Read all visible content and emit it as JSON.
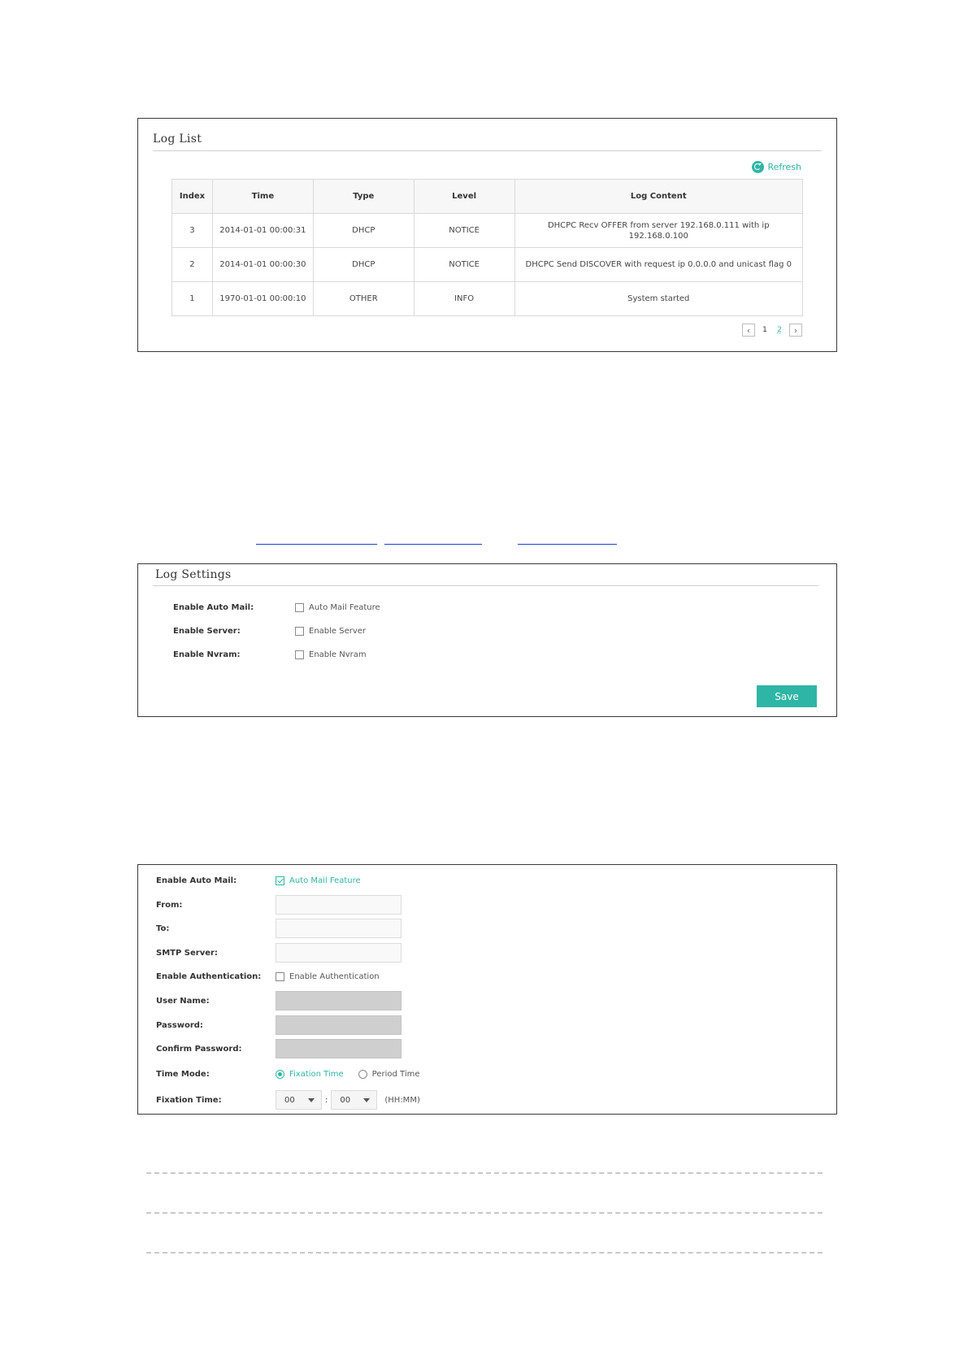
{
  "log_list": {
    "title": "Log List",
    "refresh_label": "Refresh",
    "columns": [
      "Index",
      "Time",
      "Type",
      "Level",
      "Log Content"
    ],
    "rows": [
      {
        "index": "3",
        "time": "2014-01-01 00:00:31",
        "type": "DHCP",
        "level": "NOTICE",
        "content": "DHCPC Recv OFFER from server 192.168.0.111 with ip 192.168.0.100"
      },
      {
        "index": "2",
        "time": "2014-01-01 00:00:30",
        "type": "DHCP",
        "level": "NOTICE",
        "content": "DHCPC Send DISCOVER with request ip 0.0.0.0 and unicast flag 0"
      },
      {
        "index": "1",
        "time": "1970-01-01 00:00:10",
        "type": "OTHER",
        "level": "INFO",
        "content": "System started"
      }
    ],
    "pagination": {
      "pages": [
        "1",
        "2"
      ],
      "current": "2"
    }
  },
  "log_settings": {
    "title": "Log Settings",
    "fields": [
      {
        "label": "Enable Auto Mail:",
        "option": "Auto Mail Feature",
        "checked": false
      },
      {
        "label": "Enable Server:",
        "option": "Enable Server",
        "checked": false
      },
      {
        "label": "Enable Nvram:",
        "option": "Enable Nvram",
        "checked": false
      }
    ],
    "save_label": "Save"
  },
  "mail_settings": {
    "auto_mail": {
      "label": "Enable Auto Mail:",
      "option": "Auto Mail Feature",
      "checked": true
    },
    "from_label": "From:",
    "to_label": "To:",
    "smtp_label": "SMTP Server:",
    "auth": {
      "label": "Enable Authentication:",
      "option": "Enable Authentication",
      "checked": false
    },
    "username_label": "User Name:",
    "password_label": "Password:",
    "confirm_password_label": "Confirm Password:",
    "time_mode": {
      "label": "Time Mode:",
      "options": [
        "Fixation Time",
        "Period Time"
      ],
      "selected": "Fixation Time"
    },
    "fixation_time": {
      "label": "Fixation Time:",
      "hour": "00",
      "separator": ":",
      "minute": "00",
      "hint": "(HH:MM)"
    }
  },
  "colors": {
    "accent": "#2fb5a5",
    "link_underline": "#1a3fd0"
  }
}
